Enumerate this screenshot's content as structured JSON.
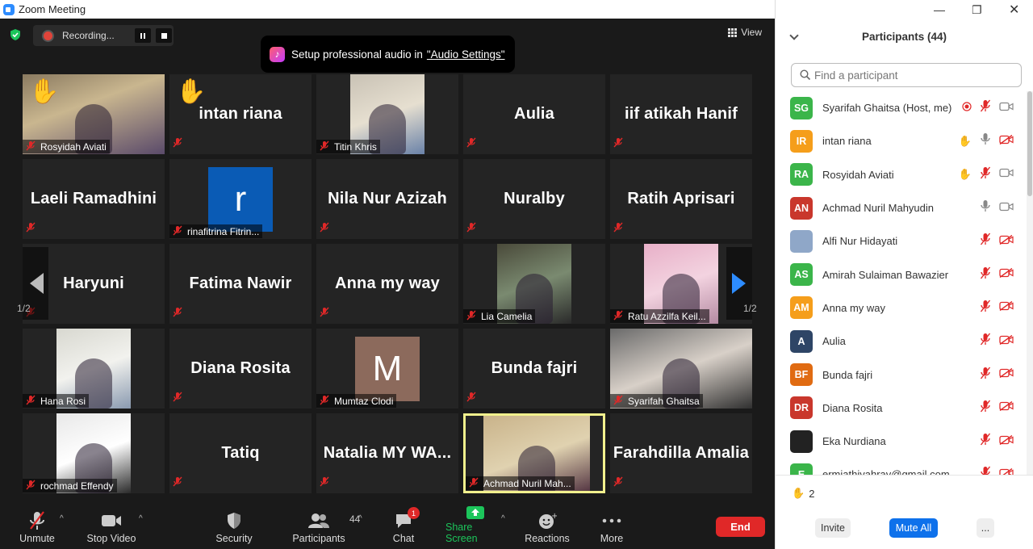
{
  "window": {
    "title": "Zoom Meeting"
  },
  "recording": {
    "label": "Recording..."
  },
  "view_label": "View",
  "banner": {
    "text": "Setup professional audio in",
    "link": "\"Audio Settings\""
  },
  "page_indicator": "1/2",
  "tiles": [
    {
      "name": "Rosyidah Aviati",
      "big": "",
      "type": "video",
      "hand": true
    },
    {
      "name": "",
      "big": "intan riana",
      "type": "name",
      "hand": true
    },
    {
      "name": "Titin Khris",
      "big": "",
      "type": "video"
    },
    {
      "name": "",
      "big": "Aulia",
      "type": "name"
    },
    {
      "name": "",
      "big": "iif atikah Hanif",
      "type": "name"
    },
    {
      "name": "",
      "big": "Laeli Ramadhini",
      "type": "name"
    },
    {
      "name": "rinafitrina Fitrin...",
      "big": "",
      "type": "letter",
      "letter": "r"
    },
    {
      "name": "",
      "big": "Nila Nur Azizah",
      "type": "name"
    },
    {
      "name": "",
      "big": "Nuralby",
      "type": "name"
    },
    {
      "name": "",
      "big": "Ratih Aprisari",
      "type": "name"
    },
    {
      "name": "",
      "big": "Haryuni",
      "type": "name"
    },
    {
      "name": "",
      "big": "Fatima Nawir",
      "type": "name"
    },
    {
      "name": "",
      "big": "Anna my way",
      "type": "name"
    },
    {
      "name": "Lia Camelia",
      "big": "",
      "type": "video"
    },
    {
      "name": "Ratu Azzilfa Keil...",
      "big": "",
      "type": "video"
    },
    {
      "name": "Hana Rosi",
      "big": "",
      "type": "video"
    },
    {
      "name": "",
      "big": "Diana Rosita",
      "type": "name"
    },
    {
      "name": "Mumtaz Clodi",
      "big": "",
      "type": "letter",
      "letter": "M"
    },
    {
      "name": "",
      "big": "Bunda fajri",
      "type": "name"
    },
    {
      "name": "Syarifah Ghaitsa",
      "big": "",
      "type": "video"
    },
    {
      "name": "rochmad Effendy",
      "big": "",
      "type": "video"
    },
    {
      "name": "",
      "big": "Tatiq",
      "type": "name"
    },
    {
      "name": "",
      "big": "Natalia MY WA...",
      "type": "name"
    },
    {
      "name": "Achmad Nuril Mah...",
      "big": "",
      "type": "video",
      "active": true
    },
    {
      "name": "",
      "big": "Farahdilla Amalia",
      "type": "name"
    }
  ],
  "toolbar": {
    "unmute": "Unmute",
    "stop_video": "Stop Video",
    "security": "Security",
    "participants": "Participants",
    "participants_count": "44",
    "chat": "Chat",
    "chat_badge": "1",
    "share_screen": "Share Screen",
    "reactions": "Reactions",
    "more": "More",
    "end": "End"
  },
  "panel": {
    "title": "Participants (44)",
    "search_placeholder": "Find a participant",
    "participants": [
      {
        "initials": "SG",
        "name": "Syarifah Ghaitsa (Host, me)",
        "color": "#3bb54a",
        "icons": "rec-mutedmic-cam"
      },
      {
        "initials": "IR",
        "name": "intan riana",
        "color": "#f59e1b",
        "icons": "hand-mic-camoff"
      },
      {
        "initials": "RA",
        "name": "Rosyidah Aviati",
        "color": "#3bb54a",
        "icons": "hand-mutedmic-cam"
      },
      {
        "initials": "AN",
        "name": "Achmad Nuril Mahyudin",
        "color": "#c9372c",
        "icons": "mic-cam"
      },
      {
        "initials": "",
        "name": "Alfi Nur Hidayati",
        "color": "#8fa7c8",
        "icons": "mutedmic-camoff"
      },
      {
        "initials": "AS",
        "name": "Amirah Sulaiman Bawazier",
        "color": "#3bb54a",
        "icons": "mutedmic-camoff"
      },
      {
        "initials": "AM",
        "name": "Anna my way",
        "color": "#f59e1b",
        "icons": "mutedmic-camoff"
      },
      {
        "initials": "A",
        "name": "Aulia",
        "color": "#2e4566",
        "icons": "mutedmic-camoff"
      },
      {
        "initials": "BF",
        "name": "Bunda fajri",
        "color": "#e06b12",
        "icons": "mutedmic-camoff"
      },
      {
        "initials": "DR",
        "name": "Diana Rosita",
        "color": "#c9372c",
        "icons": "mutedmic-camoff"
      },
      {
        "initials": "",
        "name": "Eka Nurdiana",
        "color": "#222222",
        "icons": "mutedmic-camoff"
      },
      {
        "initials": "E",
        "name": "ermiathiyahray@gmail.com",
        "color": "#3bb54a",
        "icons": "mutedmic-camoff"
      }
    ],
    "raised_hands": "2",
    "invite": "Invite",
    "mute_all": "Mute All",
    "more": "..."
  }
}
